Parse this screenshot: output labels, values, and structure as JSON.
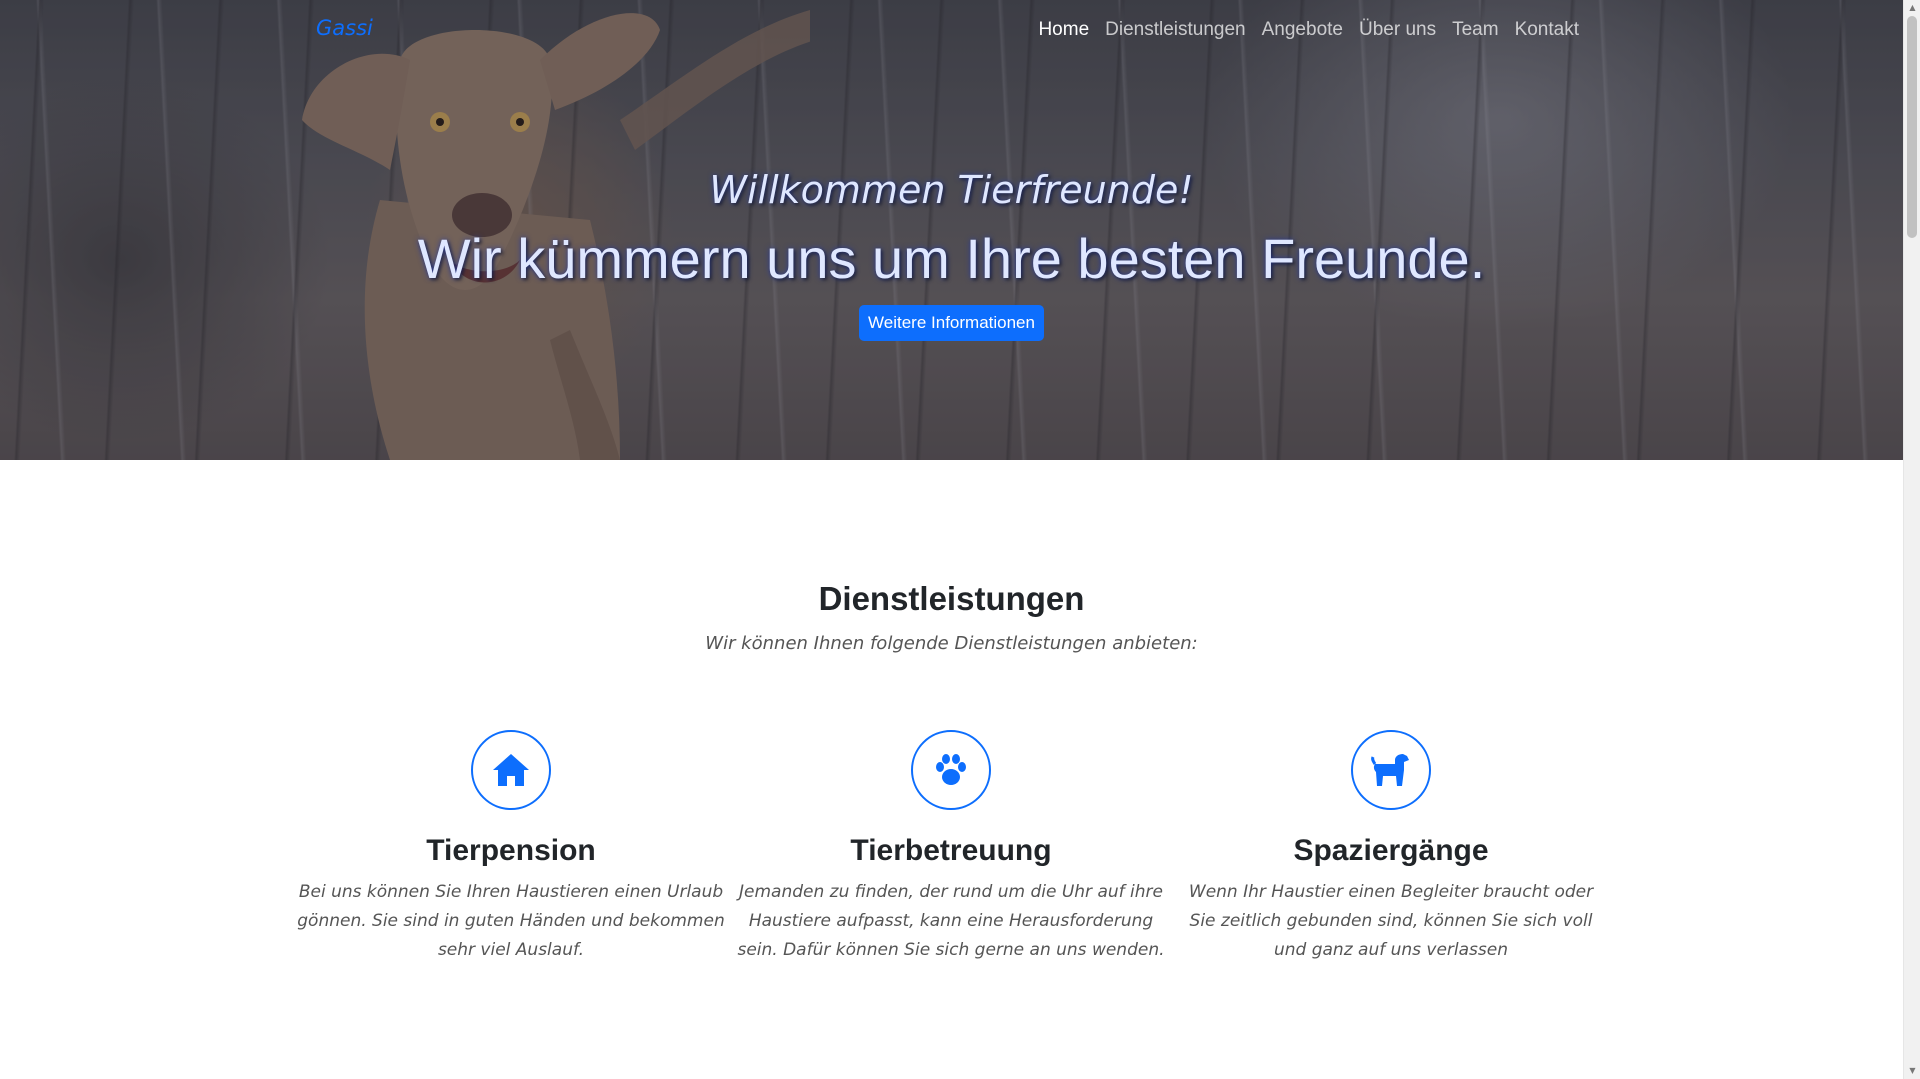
{
  "brand": {
    "name": "Gassi"
  },
  "nav": {
    "items": [
      {
        "label": "Home",
        "active": true
      },
      {
        "label": "Dienstleistungen",
        "active": false
      },
      {
        "label": "Angebote",
        "active": false
      },
      {
        "label": "Über uns",
        "active": false
      },
      {
        "label": "Team",
        "active": false
      },
      {
        "label": "Kontakt",
        "active": false
      }
    ]
  },
  "hero": {
    "subtitle": "Willkommen Tierfreunde!",
    "title": "Wir kümmern uns um Ihre besten Freunde.",
    "button_label": "Weitere Informationen"
  },
  "services": {
    "title": "Dienstleistungen",
    "subtitle": "Wir können Ihnen folgende Dienstleistungen anbieten:",
    "items": [
      {
        "icon": "house-icon",
        "title": "Tierpension",
        "text": "Bei uns können Sie Ihren Haustieren einen Urlaub gönnen. Sie sind in guten Händen und bekommen sehr viel Auslauf."
      },
      {
        "icon": "paw-icon",
        "title": "Tierbetreuung",
        "text": "Jemanden zu finden, der rund um die Uhr auf ihre Haustiere aufpasst, kann eine Herausforderung sein. Dafür können Sie sich gerne an uns wenden."
      },
      {
        "icon": "dog-icon",
        "title": "Spaziergänge",
        "text": "Wenn Ihr Haustier einen Begleiter braucht oder Sie zeitlich gebunden sind, können Sie sich voll und ganz auf uns verlassen"
      }
    ]
  },
  "colors": {
    "accent": "#0d6efd",
    "text": "#212529",
    "muted": "#555555"
  }
}
